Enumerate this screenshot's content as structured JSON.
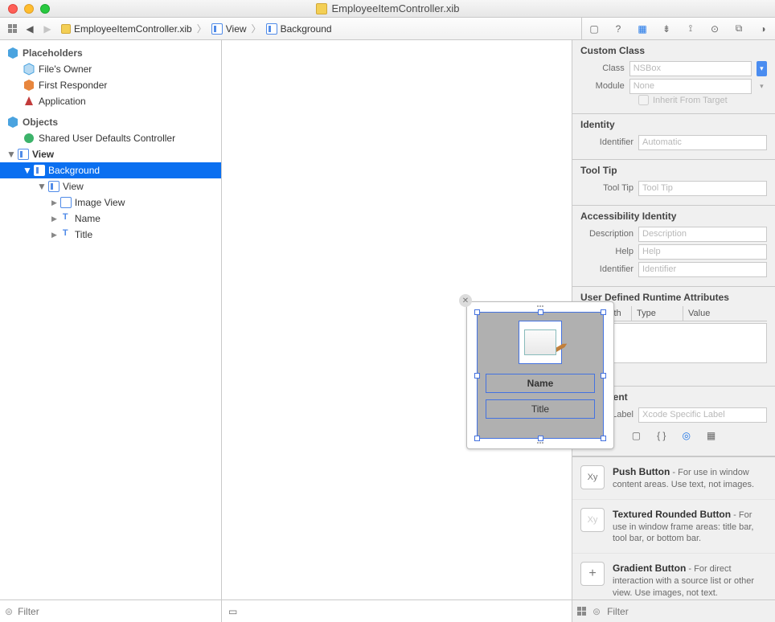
{
  "window": {
    "title": "EmployeeItemController.xib"
  },
  "jumpbar": {
    "file": "EmployeeItemController.xib",
    "path_view": "View",
    "path_bg": "Background"
  },
  "outline": {
    "placeholders_header": "Placeholders",
    "files_owner": "File's Owner",
    "first_responder": "First Responder",
    "application": "Application",
    "objects_header": "Objects",
    "shared_defaults": "Shared User Defaults Controller",
    "view": "View",
    "background": "Background",
    "inner_view": "View",
    "image_view": "Image View",
    "name": "Name",
    "title": "Title",
    "filter_placeholder": "Filter"
  },
  "canvas": {
    "name_label": "Name",
    "title_label": "Title"
  },
  "inspector": {
    "custom_class": {
      "header": "Custom Class",
      "class_label": "Class",
      "class_value": "NSBox",
      "module_label": "Module",
      "module_value": "None",
      "inherit_label": "Inherit From Target"
    },
    "identity": {
      "header": "Identity",
      "identifier_label": "Identifier",
      "identifier_placeholder": "Automatic"
    },
    "tooltip": {
      "header": "Tool Tip",
      "label": "Tool Tip",
      "placeholder": "Tool Tip"
    },
    "accessibility": {
      "header": "Accessibility Identity",
      "desc_label": "Description",
      "desc_placeholder": "Description",
      "help_label": "Help",
      "help_placeholder": "Help",
      "id_label": "Identifier",
      "id_placeholder": "Identifier"
    },
    "udra": {
      "header": "User Defined Runtime Attributes",
      "col_keypath": "Key Path",
      "col_type": "Type",
      "col_value": "Value"
    },
    "document": {
      "header": "Document",
      "label_label": "Label",
      "label_placeholder": "Xcode Specific Label"
    }
  },
  "library": {
    "items": [
      {
        "thumb": "Xy",
        "title": "Push Button",
        "desc": " - For use in window content areas. Use text, not images."
      },
      {
        "thumb": "Xy",
        "title": "Textured Rounded Button",
        "desc": " - For use in window frame areas: title bar, tool bar, or bottom bar."
      },
      {
        "thumb": "+",
        "title": "Gradient Button",
        "desc": " - For direct interaction with a source list or other view. Use images, not text."
      }
    ],
    "filter_placeholder": "Filter"
  }
}
